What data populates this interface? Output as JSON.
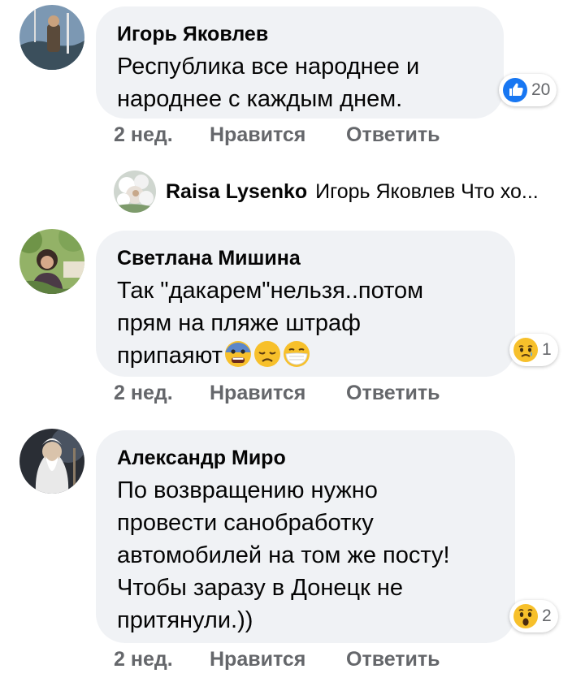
{
  "comments": [
    {
      "author": "Игорь Яковлев",
      "lines": [
        "Республика все народнее и",
        "народнее с каждым днем."
      ],
      "reaction_icon": "like-icon",
      "reaction_count": "20",
      "time": "2 нед.",
      "like_label": "Нравится",
      "reply_label": "Ответить"
    },
    {
      "author": "Светлана Мишина",
      "lines": [
        "Так \"дакарем\"нельзя..потом",
        "прям на пляже штраф",
        "припаяют"
      ],
      "inline_emojis": [
        "anxious-face-emoji",
        "disappointed-face-emoji",
        "face-with-mask-emoji"
      ],
      "reaction_icon": "sad-icon",
      "reaction_count": "1",
      "time": "2 нед.",
      "like_label": "Нравится",
      "reply_label": "Ответить"
    },
    {
      "author": "Александр Миро",
      "lines": [
        "По возвращению нужно",
        "провести санобработку",
        "автомобилей на том же посту!",
        "Чтобы заразу в Донецк не",
        "притянули.))"
      ],
      "reaction_icon": "wow-icon",
      "reaction_count": "2",
      "time": "2 нед.",
      "like_label": "Нравится",
      "reply_label": "Ответить"
    }
  ],
  "reply_preview": {
    "author": "Raisa Lysenko",
    "text": "Игорь Яковлев Что хо..."
  },
  "colors": {
    "bubble": "#f0f2f5",
    "action_text": "#65676b",
    "like_blue": "#1877f2",
    "emoji_yellow": "#f7c02b"
  }
}
